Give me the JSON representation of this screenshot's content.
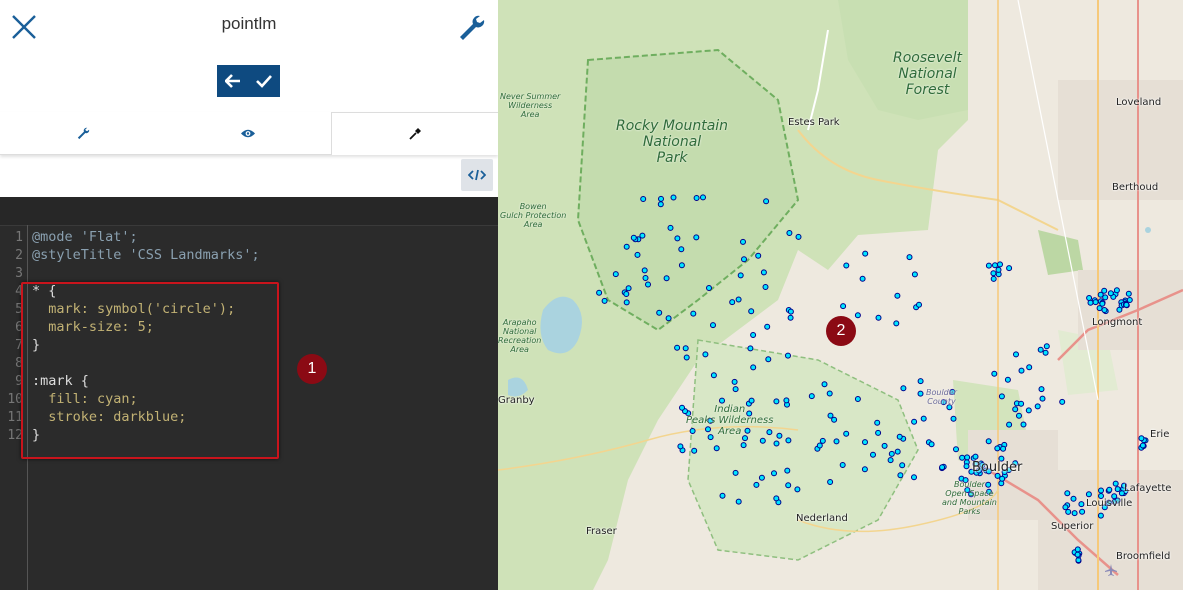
{
  "header": {
    "title": "pointlm",
    "close_icon": "close-icon",
    "settings_icon": "wrench-icon"
  },
  "toolbar": {
    "back_icon": "arrow-left-icon",
    "apply_icon": "checkmark-icon",
    "accent_color": "#0e4a80"
  },
  "tabs": [
    {
      "icon": "wrench-icon",
      "active": false
    },
    {
      "icon": "eye-icon",
      "active": false
    },
    {
      "icon": "eyedropper-icon",
      "active": true
    }
  ],
  "editor": {
    "code_toggle_icon": "code-icon",
    "line_numbers": [
      "1",
      "2",
      "3",
      "4",
      "5",
      "6",
      "7",
      "8",
      "9",
      "10",
      "11",
      "12"
    ],
    "lines": [
      "@mode 'Flat';",
      "@styleTitle 'CSS Landmarks';",
      "",
      "* {",
      "  mark: symbol('circle');",
      "  mark-size: 5;",
      "}",
      "",
      ":mark {",
      "  fill: cyan;",
      "  stroke: darkblue;",
      "}"
    ]
  },
  "annotations": [
    {
      "label": "1"
    },
    {
      "label": "2"
    }
  ],
  "map": {
    "point_fill": "#00e5ff",
    "point_stroke": "#00008b",
    "labels": {
      "never_summer": "Never Summer\nWilderness\nArea",
      "rmnp": "Rocky Mountain\nNational\nPark",
      "roosevelt": "Roosevelt\nNational\nForest",
      "estes_park": "Estes Park",
      "loveland": "Loveland",
      "berthoud": "Berthoud",
      "bowen": "Bowen\nGulch Protection\nArea",
      "arapaho": "Arapaho\nNational\nRecreation\nArea",
      "longmont": "Longmont",
      "granby": "Granby",
      "indian_peaks": "Indian\nPeaks Wilderness\nArea",
      "boulder_county": "Boulder\nCounty",
      "boulder": "Boulder",
      "open_space": "Boulder\nOpen Space\nand Mountain\nParks",
      "erie": "Erie",
      "lafayette": "Lafayette",
      "louisville": "Louisville",
      "nederland": "Nederland",
      "fraser": "Fraser",
      "superior": "Superior",
      "broomfield": "Broomfield"
    }
  }
}
